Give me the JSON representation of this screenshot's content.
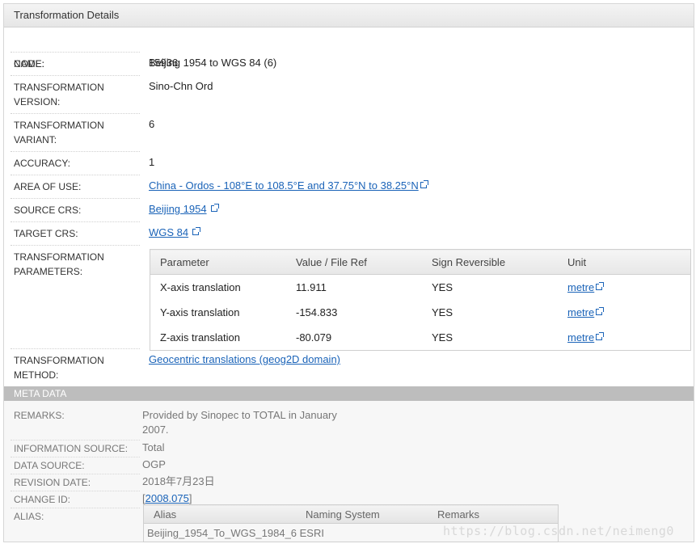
{
  "panel": {
    "title": "Transformation Details"
  },
  "fields": {
    "name": {
      "label": "NAME:",
      "value": "Beijing 1954 to WGS 84 (6)"
    },
    "code": {
      "label": "CODE:",
      "value": "15936"
    },
    "version": {
      "label1": "TRANSFORMATION",
      "label2": "VERSION:",
      "value": "Sino-Chn Ord"
    },
    "variant": {
      "label1": "TRANSFORMATION",
      "label2": "VARIANT:",
      "value": "6"
    },
    "accuracy": {
      "label": "ACCURACY:",
      "value": "1"
    },
    "area": {
      "label": "AREA OF USE:",
      "value": "China - Ordos - 108°E to 108.5°E and 37.75°N to 38.25°N"
    },
    "source": {
      "label": "SOURCE CRS:",
      "value": "Beijing 1954"
    },
    "target": {
      "label": "TARGET CRS:",
      "value": "WGS 84"
    },
    "params": {
      "label1": "TRANSFORMATION",
      "label2": "PARAMETERS:"
    },
    "method": {
      "label1": "TRANSFORMATION",
      "label2": "METHOD:",
      "value": "Geocentric translations (geog2D domain)"
    }
  },
  "params_table": {
    "headers": [
      "Parameter",
      "Value / File Ref",
      "Sign Reversible",
      "Unit"
    ],
    "rows": [
      {
        "parameter": "X-axis translation",
        "value": "11.911",
        "reversible": "YES",
        "unit": "metre"
      },
      {
        "parameter": "Y-axis translation",
        "value": "-154.833",
        "reversible": "YES",
        "unit": "metre"
      },
      {
        "parameter": "Z-axis translation",
        "value": "-80.079",
        "reversible": "YES",
        "unit": "metre"
      }
    ]
  },
  "meta": {
    "header": "META DATA",
    "remarks": {
      "label": "REMARKS:",
      "line1": "Provided by Sinopec to TOTAL in January",
      "line2": "2007."
    },
    "info_source": {
      "label": "INFORMATION SOURCE:",
      "value": "Total"
    },
    "data_source": {
      "label": "DATA SOURCE:",
      "value": "OGP"
    },
    "revision_date": {
      "label": "REVISION DATE:",
      "value": "2018年7月23日"
    },
    "change_id": {
      "label": "CHANGE ID:",
      "open": "[",
      "value": "2008.075",
      "close": "]"
    },
    "alias": {
      "label": "ALIAS:",
      "headers": [
        "Alias",
        "Naming System",
        "Remarks"
      ],
      "row": "Beijing_1954_To_WGS_1984_6 ESRI"
    }
  },
  "watermark": "https://blog.csdn.net/neimeng0"
}
